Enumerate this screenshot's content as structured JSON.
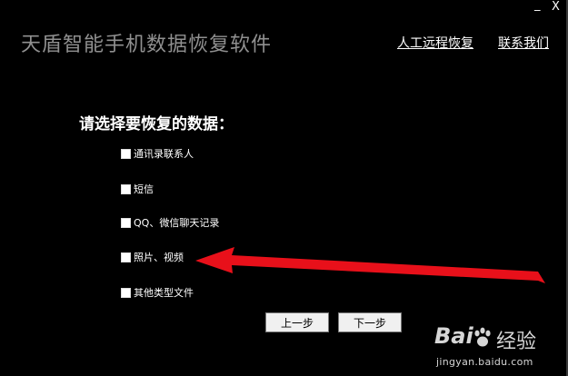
{
  "window": {
    "minimize_glyph": "_",
    "close_glyph": "X"
  },
  "header": {
    "app_title": "天盾智能手机数据恢复软件",
    "links": {
      "remote_recovery": "人工远程恢复",
      "contact_us": "联系我们"
    }
  },
  "main": {
    "prompt": "请选择要恢复的数据：",
    "options": [
      {
        "label": "通讯录联系人",
        "checked": false
      },
      {
        "label": "短信",
        "checked": false
      },
      {
        "label": "QQ、微信聊天记录",
        "checked": false
      },
      {
        "label": "照片、视频",
        "checked": false
      },
      {
        "label": "其他类型文件",
        "checked": false
      }
    ]
  },
  "buttons": {
    "prev": "上一步",
    "next": "下一步"
  },
  "annotation": {
    "arrow_color": "#e8101a"
  },
  "watermark": {
    "logo_text": "Bai",
    "logo_suffix": "经验",
    "url": "jingyan.baidu.com"
  }
}
